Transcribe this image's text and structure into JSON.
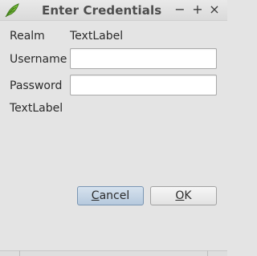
{
  "window": {
    "title": "Enter Credentials",
    "controls": {
      "minimize": "−",
      "maximize": "+",
      "close": "×"
    },
    "app_icon": "leaf-icon",
    "accent_color": "#5aa02c"
  },
  "form": {
    "realm_label": "Realm",
    "realm_value": "TextLabel",
    "username_label": "Username",
    "username_value": "",
    "password_label": "Password",
    "password_value": "",
    "message_label": "TextLabel"
  },
  "buttons": {
    "cancel": {
      "pre": "",
      "mnemonic": "C",
      "post": "ancel"
    },
    "ok": {
      "pre": "",
      "mnemonic": "O",
      "post": "K"
    }
  }
}
